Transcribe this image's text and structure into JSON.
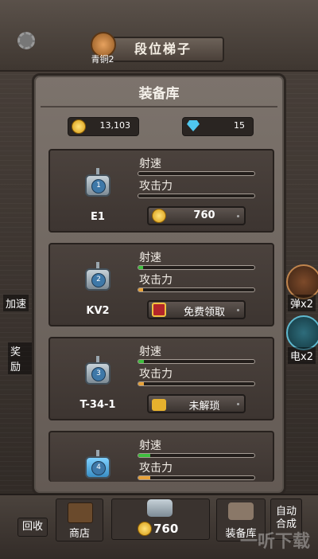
{
  "top": {
    "rank_label": "青铜2",
    "ladder_label": "段位梯子"
  },
  "side": {
    "left_speed": "加速",
    "left_reward": "奖励",
    "right_ammo": "弹x2",
    "right_power": "电x2"
  },
  "panel": {
    "title": "装备库",
    "coins": "13,103",
    "gems": "15"
  },
  "stat_labels": {
    "fire_rate": "射速",
    "attack": "攻击力"
  },
  "cards": [
    {
      "name": "E1",
      "level": "1",
      "fire_rate": 0,
      "attack": 0,
      "action": "760",
      "action_type": "coin"
    },
    {
      "name": "KV2",
      "level": "2",
      "fire_rate": 0.04,
      "attack": 0.04,
      "action": "免费领取",
      "action_type": "video"
    },
    {
      "name": "T-34-1",
      "level": "3",
      "fire_rate": 0.05,
      "attack": 0.05,
      "action": "未解琐",
      "action_type": "lock"
    },
    {
      "name": "",
      "level": "4",
      "fire_rate": 0.1,
      "attack": 0.1
    }
  ],
  "bottom": {
    "recycle": "回收",
    "shop": "商店",
    "buy_price": "760",
    "armory": "装备库",
    "auto_merge": "自动\n合成"
  },
  "watermark": "一听下载",
  "colors": {
    "fire_rate_fill": "#3fbf3f",
    "attack_fill": "#e7a23a"
  }
}
